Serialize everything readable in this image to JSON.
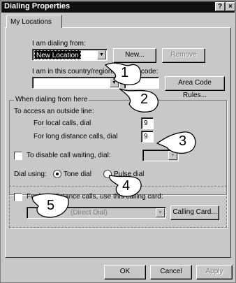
{
  "window": {
    "title": "Dialing Properties",
    "help_glyph": "?",
    "close_glyph": "×"
  },
  "tab": {
    "label": "My Locations"
  },
  "location": {
    "dialing_from_label": "I am dialing from:",
    "dialing_from_value": "New Location",
    "new_button": "New...",
    "remove_button": "Remove",
    "country_label": "I am in this country/region:",
    "area_code_label": "Area code:",
    "area_code_rules_button": "Area Code Rules..."
  },
  "dialing": {
    "group_label": "When dialing from here",
    "outside_line_label": "To access an outside line:",
    "local_label": "For local calls, dial",
    "local_value": "9",
    "long_distance_label": "For long distance calls, dial",
    "long_distance_value": "9",
    "call_waiting_label": "To disable call waiting, dial:",
    "dial_using_label": "Dial using:",
    "tone_label": "Tone dial",
    "pulse_label": "Pulse dial",
    "calling_card_checkbox_label": "For long distance calls, use this calling card:",
    "calling_card_value": "(Direct Dial)",
    "calling_card_button": "Calling Card..."
  },
  "footer": {
    "ok": "OK",
    "cancel": "Cancel",
    "apply": "Apply"
  },
  "callouts": [
    "1",
    "2",
    "3",
    "4",
    "5"
  ]
}
